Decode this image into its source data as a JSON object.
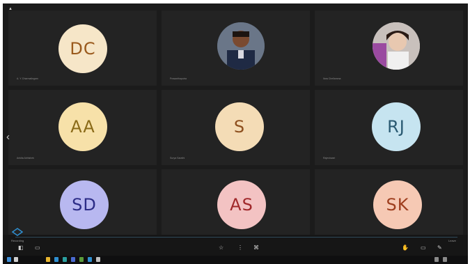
{
  "participants": [
    {
      "initials": "DC",
      "name": "A. Y. Dharmalingam",
      "bg": "#f6e6c8",
      "fg": "#9a5a1d"
    },
    {
      "initials": "",
      "name": "Prasanthaputra",
      "photo": "man"
    },
    {
      "initials": "",
      "name": "Ilara Chellamma",
      "photo": "woman"
    },
    {
      "initials": "AA",
      "name": "Ankita Abhishek",
      "bg": "#f7e1a9",
      "fg": "#8a6a18"
    },
    {
      "initials": "S",
      "name": "Surya Sarathi",
      "bg": "#f4dcb6",
      "fg": "#8d4f1e"
    },
    {
      "initials": "RJ",
      "name": "Rajeshwari",
      "bg": "#c6e4f0",
      "fg": "#2a5a72"
    },
    {
      "initials": "SD",
      "name": "",
      "bg": "#b8b8f0",
      "fg": "#2c2c86"
    },
    {
      "initials": "AS",
      "name": "",
      "bg": "#f3c3c3",
      "fg": "#a0282a"
    },
    {
      "initials": "SK",
      "name": "",
      "bg": "#f6c9b4",
      "fg": "#9e3e1e"
    }
  ],
  "toolbar": {
    "left_label": "Recording",
    "right_label": "Leave"
  },
  "colors": {
    "bg": "#1b1b1b",
    "tile": "#232323",
    "accent": "#2f8fd0"
  }
}
